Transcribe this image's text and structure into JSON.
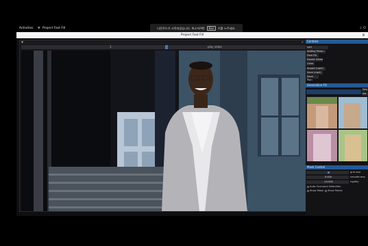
{
  "system": {
    "activities": "Activities",
    "app_name": "Project Fast Fill",
    "notification": "다운로드가 시작되었습니다. 취소하려면",
    "notification_key": "Esc",
    "notification_tail": "키를 누르세요."
  },
  "window": {
    "title": "Project Fast Fill"
  },
  "video": {
    "slider_mid": "1",
    "slider_label": "play video",
    "scrubber_position": 0.5
  },
  "controls": {
    "title": "Controls",
    "dropdown_value": "Lert",
    "items": [
      "Adding Perso...",
      "Face Fill",
      "Export Video",
      "Clear",
      "Import (mp4)",
      "Save (mp4)",
      "Save Plan"
    ]
  },
  "generative_fill": {
    "title": "Generative Fill",
    "side_buttons": [
      "Gen",
      "Iter"
    ]
  },
  "mask_control": {
    "title": "Mask Control",
    "rows": [
      {
        "value": "",
        "label": "grid size"
      },
      {
        "value": "0.000",
        "label": "smoothness"
      },
      {
        "value": "-10.000",
        "label": "rigidity"
      }
    ],
    "checkbox_motion": "Auto Occlusion Detection",
    "checkbox_mask": "Show Mask",
    "checkbox_points": "Show Points"
  }
}
